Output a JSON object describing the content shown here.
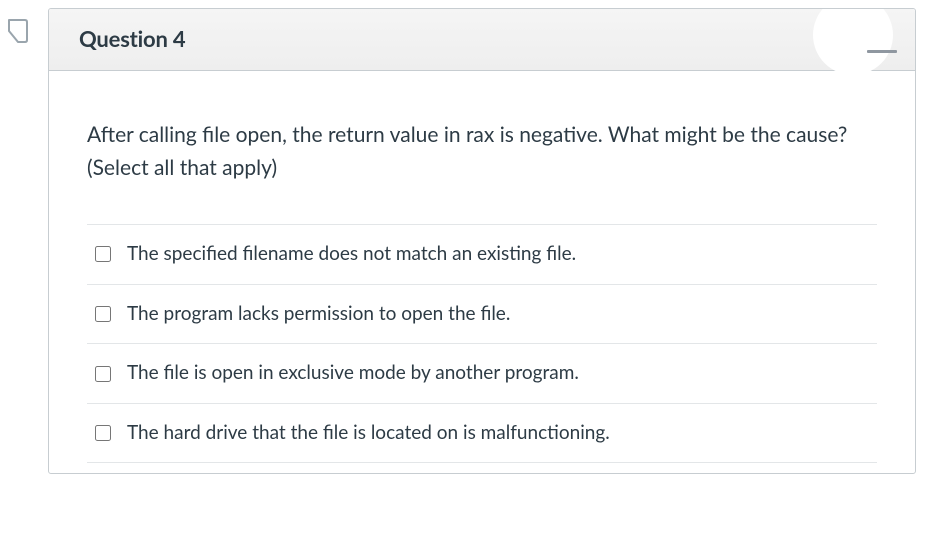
{
  "question": {
    "title": "Question 4",
    "prompt": "After calling file open, the return value in rax is negative.  What might be the cause?  (Select all that apply)",
    "options": [
      {
        "label": "The specified filename does not match an existing file."
      },
      {
        "label": "The program lacks permission to open the file."
      },
      {
        "label": "The file is open in exclusive mode by another program."
      },
      {
        "label": "The hard drive that the file is located on is malfunctioning."
      }
    ]
  }
}
